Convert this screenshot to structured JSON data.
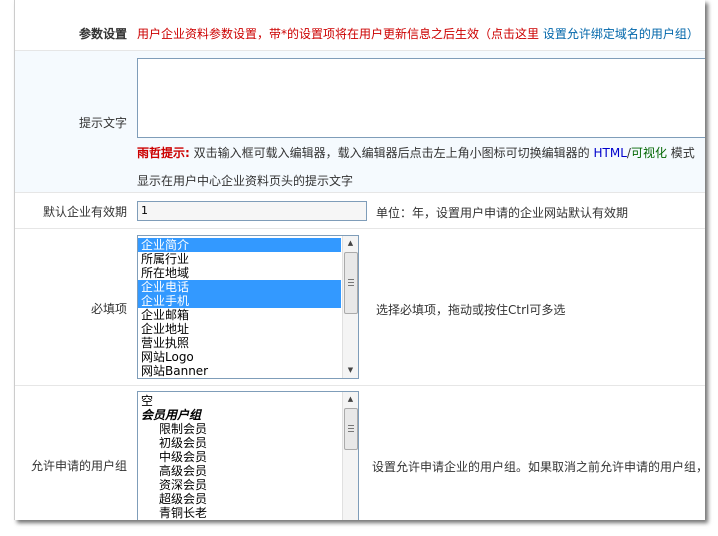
{
  "params": {
    "label": "参数设置",
    "note_red": "用户企业资料参数设置，带*的设置项将在用户更新信息之后生效（点击这里",
    "note_link": "设置允许绑定域名的用户组）"
  },
  "tips": {
    "label": "提示文字",
    "value": "",
    "editor_prefix": "雨哲提示:",
    "editor_text": "双击输入框可载入编辑器，载入编辑器后点击左上角小图标可切换编辑器的",
    "html_label": "HTML",
    "slash": "/",
    "visual_label": "可视化",
    "mode_suffix": "模式",
    "desc": "显示在用户中心企业资料页头的提示文字"
  },
  "validity": {
    "label": "默认企业有效期",
    "value": "1",
    "help": "单位：年，设置用户申请的企业网站默认有效期"
  },
  "required": {
    "label": "必填项",
    "help": "选择必填项，拖动或按住Ctrl可多选",
    "options": [
      {
        "text": "企业简介",
        "selected": true
      },
      {
        "text": "所属行业",
        "selected": false
      },
      {
        "text": "所在地域",
        "selected": false
      },
      {
        "text": "企业电话",
        "selected": true
      },
      {
        "text": "企业手机",
        "selected": true
      },
      {
        "text": "企业邮箱",
        "selected": false
      },
      {
        "text": "企业地址",
        "selected": false
      },
      {
        "text": "营业执照",
        "selected": false
      },
      {
        "text": "网站Logo",
        "selected": false
      },
      {
        "text": "网站Banner",
        "selected": false
      }
    ]
  },
  "groups": {
    "label": "允许申请的用户组",
    "help": "设置允许申请企业的用户组。如果取消之前允许申请的用户组，",
    "empty_option": "空",
    "optgroup": "会员用户组",
    "members": [
      "限制会员",
      "初级会员",
      "中级会员",
      "高级会员",
      "资深会员",
      "超级会员",
      "青铜长老"
    ]
  }
}
